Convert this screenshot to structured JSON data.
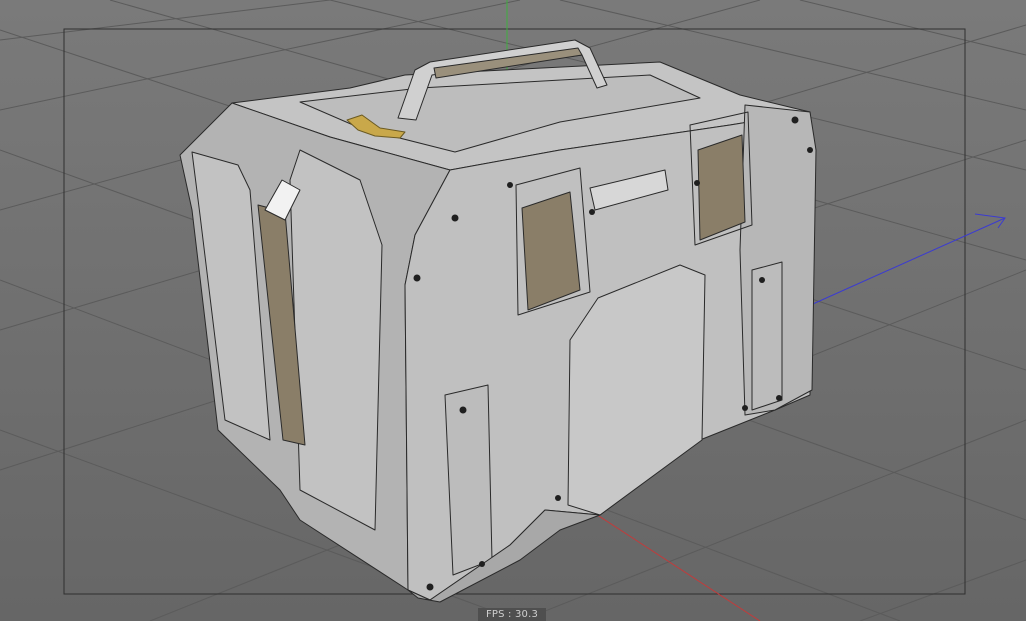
{
  "viewport": {
    "fps_label": "FPS : 30.3",
    "background_color": "#6f6f6f",
    "grid_color": "#5a5a5a",
    "safe_frame_color": "#2e2e2e",
    "axis_colors": {
      "x": "#c43a3a",
      "y": "#3fae3f",
      "z": "#3b3bd1"
    },
    "model_colors": {
      "body": "#b9b9b9",
      "edges": "#2a2a2a",
      "inset": "#8a7e68",
      "latch": "#c9a84a"
    }
  }
}
